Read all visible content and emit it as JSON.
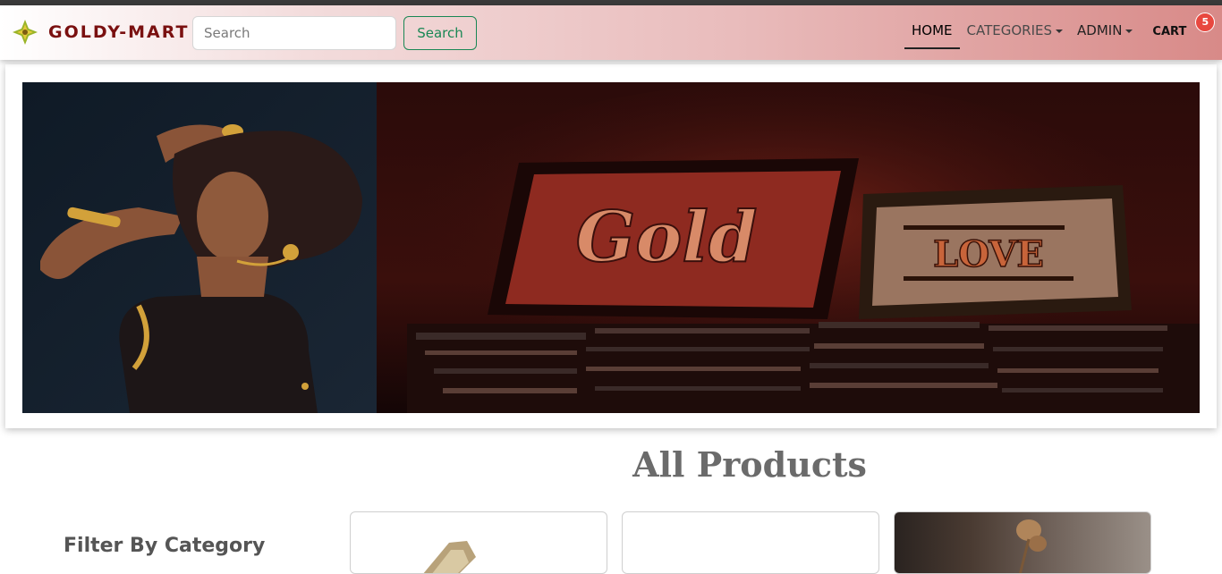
{
  "brand": {
    "name": "GOLDY-MART",
    "logo_icon": "gold-leaf-icon"
  },
  "search": {
    "placeholder": "Search",
    "button_label": "Search"
  },
  "nav": {
    "home": "HOME",
    "categories": "CATEGORIES",
    "admin": "ADMIN",
    "cart": "CART",
    "cart_count": "5"
  },
  "banner": {
    "sign_left": "Gold",
    "sign_right": "LOVE"
  },
  "main": {
    "heading": "All Products"
  },
  "sidebar": {
    "filter_title": "Filter By Category"
  },
  "colors": {
    "brand": "#7a1010",
    "search_button": "#198754",
    "badge": "#e8483f"
  }
}
